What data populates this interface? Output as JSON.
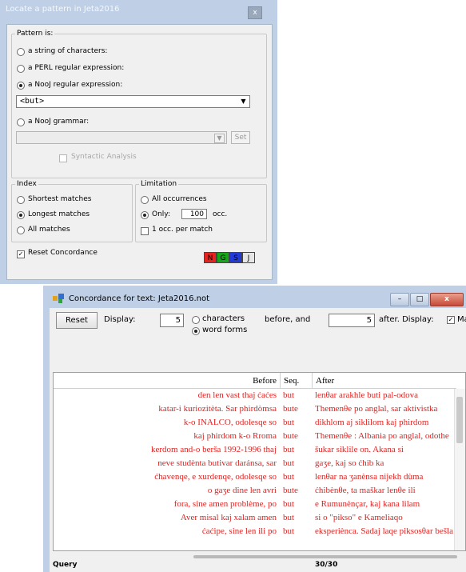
{
  "locate_dialog": {
    "title": "Locate a pattern in Jeta2016",
    "close_glyph": "x",
    "pattern_group": "Pattern is:",
    "options": {
      "string": "a string of characters:",
      "perl": "a PERL regular expression:",
      "nooj_regex": "a NooJ regular expression:",
      "nooj_grammar": "a NooJ grammar:"
    },
    "selected_option": "nooj_regex",
    "regex_value": "<but>",
    "grammar_value": "",
    "set_button": "Set",
    "syntactic_analysis": "Syntactic Analysis",
    "index": {
      "legend": "Index",
      "shortest": "Shortest matches",
      "longest": "Longest matches",
      "all": "All matches",
      "selected": "longest"
    },
    "limitation": {
      "legend": "Limitation",
      "all_occurrences": "All occurrences",
      "only": "Only:",
      "only_value": "100",
      "occ_suffix": "occ.",
      "one_per_match": "1 occ. per match",
      "selected": "only"
    },
    "reset_concordance": "Reset Concordance",
    "color_buttons": [
      {
        "letter": "N",
        "color": "#e8231e"
      },
      {
        "letter": "G",
        "color": "#17a51a"
      },
      {
        "letter": "S",
        "color": "#2039d8"
      },
      {
        "letter": "J",
        "color": "#e6e6e6"
      }
    ]
  },
  "concordance_window": {
    "title": "Concordance for text: Jeta2016.not",
    "minimize": "–",
    "maximize": "□",
    "close": "x",
    "reset_button": "Reset",
    "display_label": "Display:",
    "before_value": "5",
    "characters_label": "characters",
    "word_forms_label": "word forms",
    "unit_selected": "word_forms",
    "before_and": "before, and",
    "after_value": "5",
    "after_display": "after. Display:",
    "display_cut": "Ma",
    "columns": {
      "before": "Before",
      "seq": "Seq.",
      "after": "After"
    },
    "rows": [
      {
        "before": "den len vast thaj ćaćes",
        "seq": "but",
        "after": "lenθar arakhle buti pal-odova"
      },
      {
        "before": "katar-i kuriozitèta. Sar phirdòmsa",
        "seq": "bute",
        "after": "Themenθe po anglal, sar aktivistka"
      },
      {
        "before": "k-o INALCO, odolesqe so",
        "seq": "but",
        "after": "dikhlom aj siklilom kaj phirdom"
      },
      {
        "before": "kaj phirdom k-o Rroma",
        "seq": "bute",
        "after": "Themenθe : Albania po anglal, odothe"
      },
      {
        "before": "kerdom and-o berša 1992-1996 thaj",
        "seq": "but",
        "after": "šukar siklile on. Akana si"
      },
      {
        "before": "neve studènta butivar daránsa, sar",
        "seq": "but",
        "after": "gaʒe, kaj so ćhib ka"
      },
      {
        "before": "ćhavenqe, e xurdenqe, odolesqe so",
        "seq": "but",
        "after": "lenθar na ʒanènsa nijekh dùma"
      },
      {
        "before": "o gaʒe dine len avri",
        "seq": "bute",
        "after": "ćhibènθe, ta maškar lenθe ili"
      },
      {
        "before": "fora, sine amen problème, po",
        "seq": "but",
        "after": "e Rumunènçar, kaj kana lilam"
      },
      {
        "before": "Aver misal kaj xalam amen",
        "seq": "but",
        "after": "si o \"pikso\" e Kameliaqo"
      },
      {
        "before": "ćaćipe, sine len ili po",
        "seq": "but",
        "after": "eksperiènca. Sadaj laqe piksosθar bešla"
      }
    ],
    "status_left": "Query",
    "status_count": "30/30"
  }
}
